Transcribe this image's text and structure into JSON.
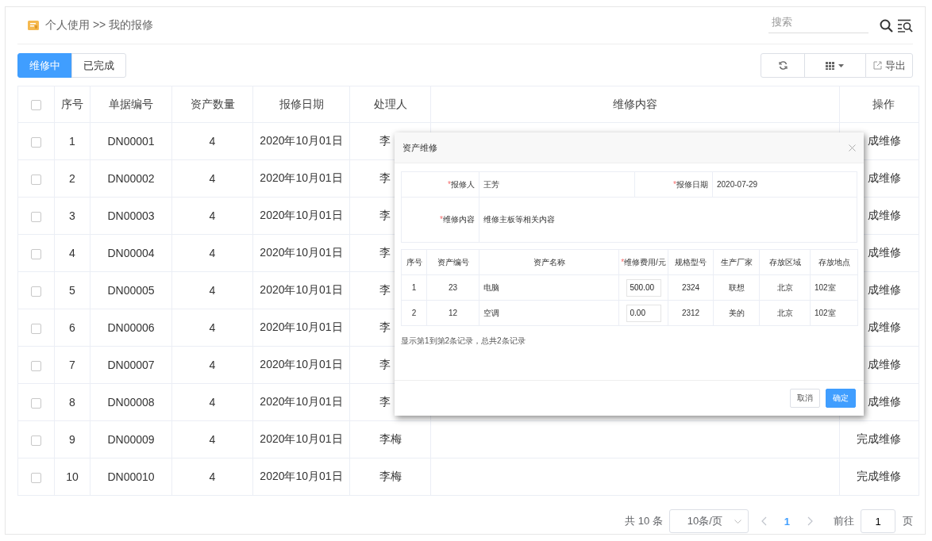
{
  "breadcrumb": "个人使用 >> 我的报修",
  "search": {
    "placeholder": "搜索"
  },
  "tabs": [
    {
      "label": "维修中",
      "selected": true
    },
    {
      "label": "已完成",
      "selected": false
    }
  ],
  "toolbar": {
    "export_label": "导出"
  },
  "table": {
    "columns": [
      "序号",
      "单据编号",
      "资产数量",
      "报修日期",
      "处理人",
      "维修内容",
      "操作"
    ],
    "header_checked": false,
    "rows": [
      {
        "checked": false,
        "index": "1",
        "doc_no": "DN00001",
        "qty": "4",
        "date": "2020年10月01日",
        "handler": "李",
        "action": "成维修"
      },
      {
        "checked": false,
        "index": "2",
        "doc_no": "DN00002",
        "qty": "4",
        "date": "2020年10月01日",
        "handler": "李",
        "action": "成维修"
      },
      {
        "checked": false,
        "index": "3",
        "doc_no": "DN00003",
        "qty": "4",
        "date": "2020年10月01日",
        "handler": "李",
        "action": "成维修"
      },
      {
        "checked": false,
        "index": "4",
        "doc_no": "DN00004",
        "qty": "4",
        "date": "2020年10月01日",
        "handler": "李",
        "action": "成维修"
      },
      {
        "checked": false,
        "index": "5",
        "doc_no": "DN00005",
        "qty": "4",
        "date": "2020年10月01日",
        "handler": "李",
        "action": "成维修"
      },
      {
        "checked": false,
        "index": "6",
        "doc_no": "DN00006",
        "qty": "4",
        "date": "2020年10月01日",
        "handler": "李",
        "action": "成维修"
      },
      {
        "checked": false,
        "index": "7",
        "doc_no": "DN00007",
        "qty": "4",
        "date": "2020年10月01日",
        "handler": "李",
        "action": "成维修"
      },
      {
        "checked": false,
        "index": "8",
        "doc_no": "DN00008",
        "qty": "4",
        "date": "2020年10月01日",
        "handler": "李",
        "action": "成维修"
      },
      {
        "checked": false,
        "index": "9",
        "doc_no": "DN00009",
        "qty": "4",
        "date": "2020年10月01日",
        "handler": "李梅",
        "action": "完成维修"
      },
      {
        "checked": false,
        "index": "10",
        "doc_no": "DN00010",
        "qty": "4",
        "date": "2020年10月01日",
        "handler": "李梅",
        "action": "完成维修"
      }
    ]
  },
  "pagination": {
    "total": "共 10 条",
    "page_size": "10条/页",
    "pages": [
      {
        "label": "1",
        "selected": true
      }
    ],
    "goto_label": "前往",
    "goto_value": "1",
    "page_unit": "页"
  },
  "dialog": {
    "title": "资产维修",
    "form": [
      {
        "label": "报修人",
        "required_mark": "*",
        "value": "王芳"
      },
      {
        "label": "报修日期",
        "required_mark": "*",
        "value": "2020-07-29"
      },
      {
        "label": "维修内容",
        "required_mark": "*",
        "value": "维修主板等相关内容"
      }
    ],
    "detail_columns": [
      {
        "label": "序号"
      },
      {
        "label": "资产编号"
      },
      {
        "label": "资产名称"
      },
      {
        "label": "维修费用/元",
        "required_mark": "*"
      },
      {
        "label": "规格型号"
      },
      {
        "label": "生产厂家"
      },
      {
        "label": "存放区域"
      },
      {
        "label": "存放地点"
      }
    ],
    "detail_rows": [
      {
        "index": "1",
        "asset_no": "23",
        "name": "电脑",
        "cost": "500.00",
        "model": "2324",
        "maker": "联想",
        "area": "北京",
        "location": "102室"
      },
      {
        "index": "2",
        "asset_no": "12",
        "name": "空调",
        "cost": "0.00",
        "model": "2312",
        "maker": "美的",
        "area": "北京",
        "location": "102室"
      }
    ],
    "summary": "显示第1到第2条记录，总共2条记录",
    "buttons": [
      {
        "kind": "cancel",
        "label": "取消"
      },
      {
        "kind": "confirm",
        "label": "确定"
      }
    ]
  }
}
